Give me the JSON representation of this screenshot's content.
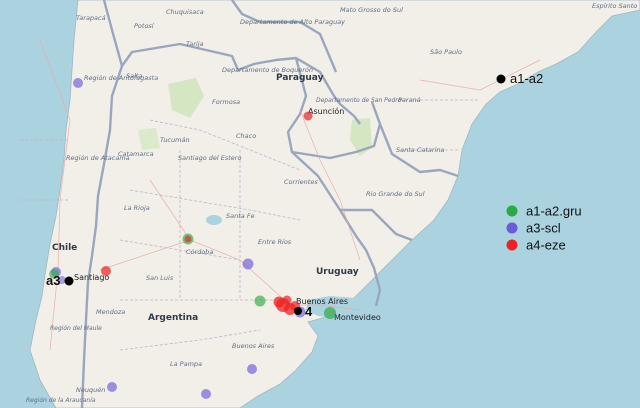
{
  "legend": [
    {
      "label": "a1-a2.gru",
      "color": "#2eaa44"
    },
    {
      "label": "a3-scl",
      "color": "#6a5ad8"
    },
    {
      "label": "a4-eze",
      "color": "#ee2222"
    }
  ],
  "nodes": {
    "a1_a2": "a1-a2",
    "a3": "a3",
    "a4": "4"
  },
  "countries": {
    "paraguay": "Paraguay",
    "argentina": "Argentina",
    "uruguay": "Uruguay",
    "chile": "Chile"
  },
  "cities": {
    "asuncion": "Asunción",
    "santiago": "Santiago",
    "buenos_aires": "Buenos Aires",
    "montevideo": "Montevideo"
  },
  "regions": {
    "chuquisaca": "Chuquisaca",
    "tarija": "Tarija",
    "potosi": "Potosí",
    "tarapaca": "Tarapacá",
    "alto_paraguay": "Departamento de Alto Paraguay",
    "boqueron": "Departamento de Boquerón",
    "mato_grosso": "Mato Grosso do Sul",
    "sao_paulo": "São Paulo",
    "espirito_santo": "Espírito Santo",
    "antofagasta": "Región de Antofagasta",
    "atacama": "Región de Atacama",
    "formosa": "Formosa",
    "salta": "Salta",
    "parana": "Paraná",
    "san_pedro": "Departamento de San Pedro",
    "tucuman": "Tucumán",
    "catamarca": "Catamarca",
    "santiago_estero": "Santiago del Estero",
    "chaco": "Chaco",
    "corrientes": "Corrientes",
    "santa_catarina": "Santa Catarina",
    "rio_grande": "Rio Grande do Sul",
    "la_rioja": "La Rioja",
    "santa_fe": "Santa Fe",
    "cordoba": "Córdoba",
    "san_luis": "San Luis",
    "entre_rios": "Entre Ríos",
    "mendoza": "Mendoza",
    "la_pampa": "La Pampa",
    "buenos_aires_prov": "Buenos Aires",
    "neuquen": "Neuquén",
    "maule": "Región del Maule",
    "araucania": "Región de la Araucanía"
  }
}
